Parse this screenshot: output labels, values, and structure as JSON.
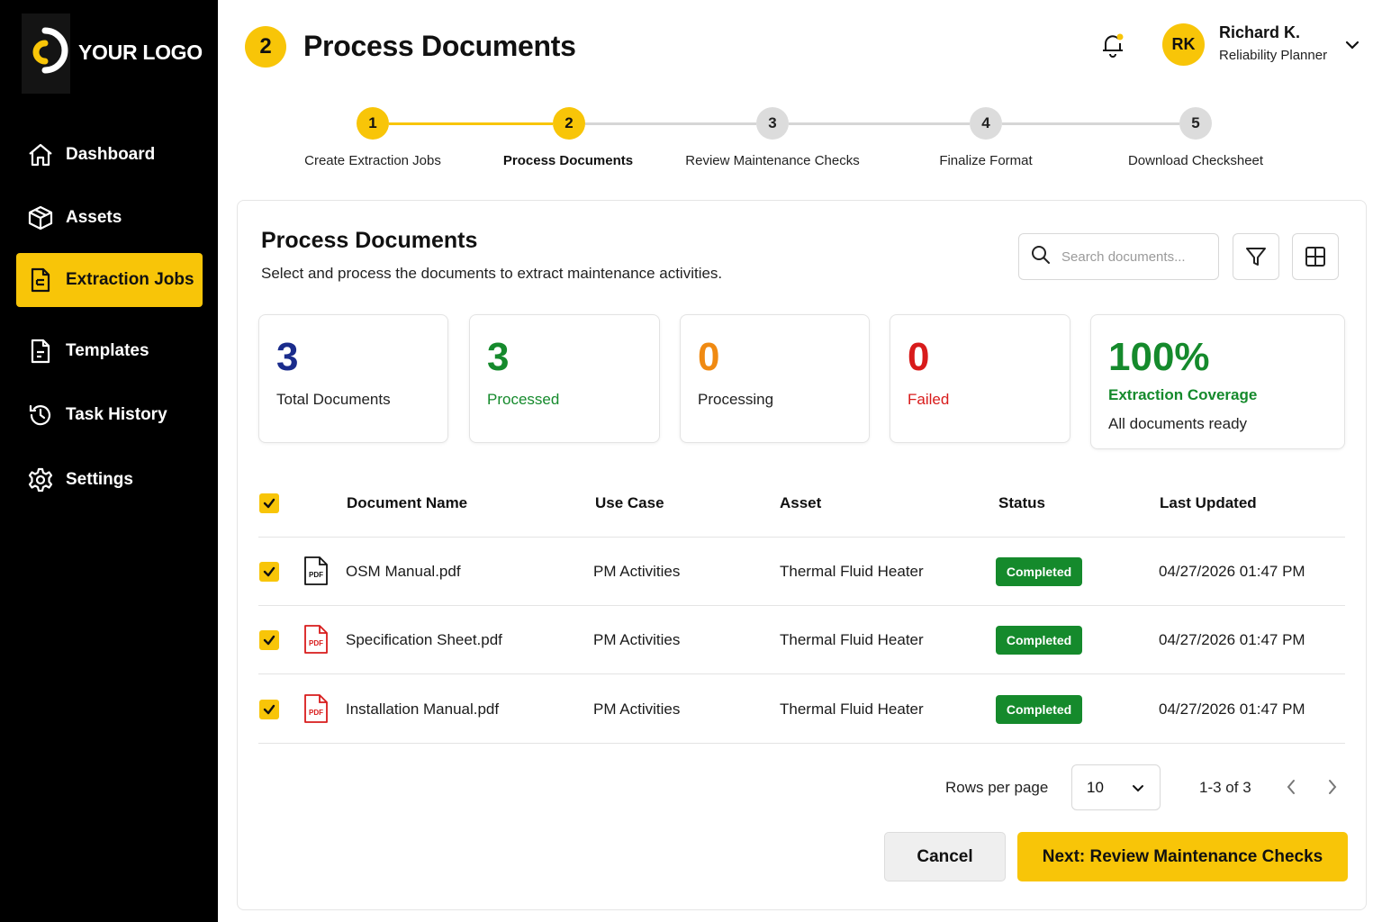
{
  "brand": {
    "logo_text": "YOUR LOGO",
    "accent": "#F8C508"
  },
  "sidebar": {
    "items": [
      {
        "label": "Dashboard",
        "icon": "home-icon",
        "active": false
      },
      {
        "label": "Assets",
        "icon": "box-icon",
        "active": false
      },
      {
        "label": "Extraction Jobs",
        "icon": "document-icon",
        "active": true
      },
      {
        "label": "Templates",
        "icon": "template-icon",
        "active": false
      },
      {
        "label": "Task History",
        "icon": "history-icon",
        "active": false
      },
      {
        "label": "Settings",
        "icon": "gear-icon",
        "active": false
      }
    ]
  },
  "header": {
    "step_number": "2",
    "title": "Process Documents",
    "user": {
      "initials": "RK",
      "name": "Richard K.",
      "role": "Reliability Planner"
    }
  },
  "stepper": {
    "steps": [
      {
        "number": "1",
        "label": "Create Extraction Jobs",
        "state": "done"
      },
      {
        "number": "2",
        "label": "Process Documents",
        "state": "current"
      },
      {
        "number": "3",
        "label": "Review Maintenance Checks",
        "state": "todo"
      },
      {
        "number": "4",
        "label": "Finalize Format",
        "state": "todo"
      },
      {
        "number": "5",
        "label": "Download Checksheet",
        "state": "todo"
      }
    ]
  },
  "card": {
    "title": "Process Documents",
    "subtitle": "Select and process the documents to extract maintenance activities.",
    "search_placeholder": "Search documents..."
  },
  "stats": [
    {
      "value": "3",
      "label": "Total Documents",
      "color": "#1A2C8C",
      "label_color": "#222222"
    },
    {
      "value": "3",
      "label": "Processed",
      "color": "#158A2C",
      "label_color": "#158A2C"
    },
    {
      "value": "0",
      "label": "Processing",
      "color": "#F08A12",
      "label_color": "#222222"
    },
    {
      "value": "0",
      "label": "Failed",
      "color": "#D81B1B",
      "label_color": "#D81B1B"
    },
    {
      "value": "100%",
      "label": "Extraction Coverage",
      "extra": "All documents ready",
      "color": "#158A2C",
      "label_color": "#158A2C"
    }
  ],
  "table": {
    "headers": [
      "Document Name",
      "Use Case",
      "Asset",
      "Status",
      "Last Updated"
    ],
    "rows": [
      {
        "name": "OSM Manual.pdf",
        "use_case": "PM Activities",
        "asset": "Thermal Fluid Heater",
        "status": "Completed",
        "updated": "04/27/2026 01:47 PM",
        "file_icon": "pdf-icon-black",
        "checked": true
      },
      {
        "name": "Specification Sheet.pdf",
        "use_case": "PM Activities",
        "asset": "Thermal Fluid Heater",
        "status": "Completed",
        "updated": "04/27/2026 01:47 PM",
        "file_icon": "pdf-icon-red",
        "checked": true
      },
      {
        "name": "Installation Manual.pdf",
        "use_case": "PM Activities",
        "asset": "Thermal Fluid Heater",
        "status": "Completed",
        "updated": "04/27/2026 01:47 PM",
        "file_icon": "pdf-icon-red",
        "checked": true
      }
    ]
  },
  "pagination": {
    "rows_per_page_label": "Rows per page",
    "rows_per_page": "10",
    "range": "1-3 of 3"
  },
  "actions": {
    "cancel": "Cancel",
    "next": "Next: Review Maintenance Checks"
  },
  "icons": {
    "pdf_label": "PDF"
  }
}
